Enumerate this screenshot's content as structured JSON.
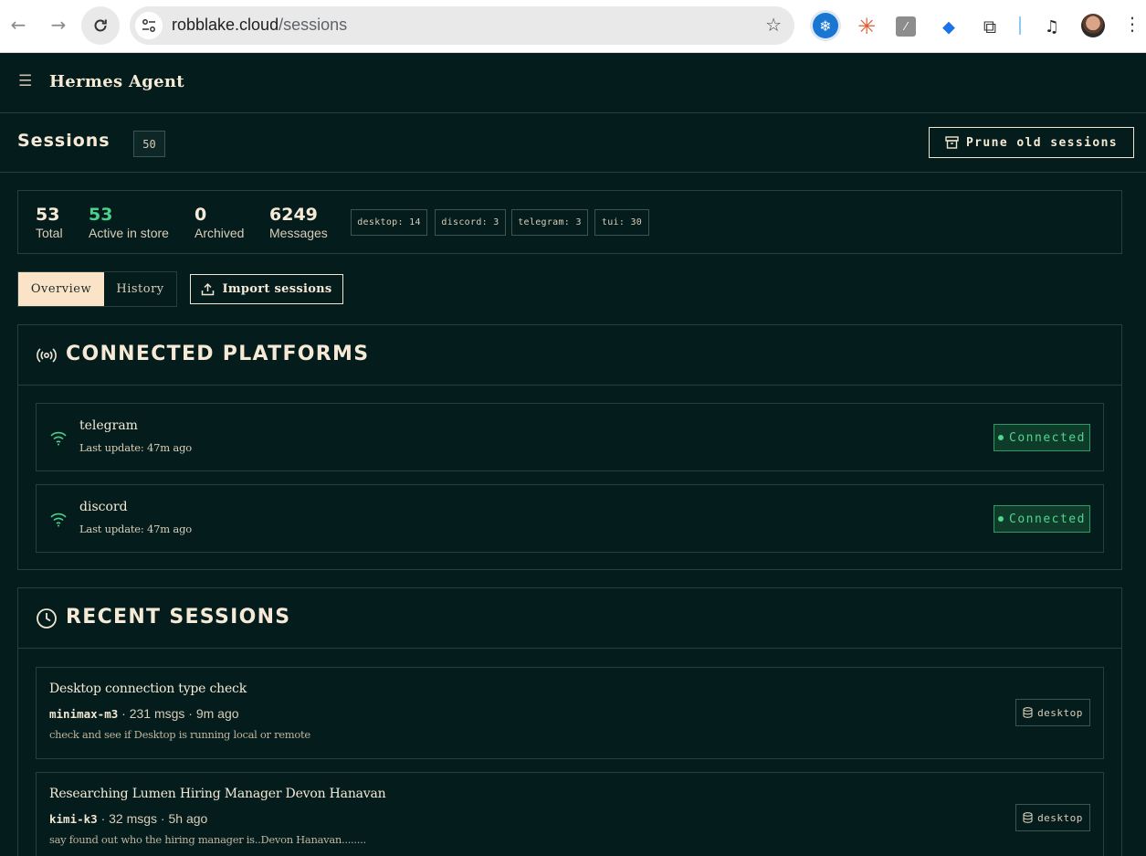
{
  "browser": {
    "url_host": "robblake.cloud",
    "url_path": "/sessions"
  },
  "app": {
    "title": "Hermes Agent"
  },
  "sessions_header": {
    "title": "Sessions",
    "count": "50",
    "prune_label": "Prune old sessions"
  },
  "stats": [
    {
      "value": "53",
      "label": "Total"
    },
    {
      "value": "53",
      "label": "Active in store"
    },
    {
      "value": "0",
      "label": "Archived"
    },
    {
      "value": "6249",
      "label": "Messages"
    }
  ],
  "source_tags": [
    "desktop: 14",
    "discord: 3",
    "telegram: 3",
    "tui: 30"
  ],
  "tabs": [
    {
      "label": "Overview",
      "active": true
    },
    {
      "label": "History",
      "active": false
    }
  ],
  "import_label": "Import sessions",
  "platforms": {
    "title": "CONNECTED PLATFORMS",
    "items": [
      {
        "name": "telegram",
        "update": "Last update: 47m ago",
        "status": "Connected"
      },
      {
        "name": "discord",
        "update": "Last update: 47m ago",
        "status": "Connected"
      }
    ]
  },
  "recent": {
    "title": "RECENT SESSIONS",
    "items": [
      {
        "title": "Desktop connection type check",
        "model": "minimax-m3",
        "meta": " · 231 msgs · 9m ago",
        "desc": "check and see if Desktop is running local or remote",
        "source": "desktop"
      },
      {
        "title": "Researching Lumen Hiring Manager Devon Hanavan",
        "model": "kimi-k3",
        "meta": " · 32 msgs · 5h ago",
        "desc": "say found out who the hiring manager is..Devon Hanavan........",
        "source": "desktop"
      }
    ]
  },
  "colors": {
    "background": "#041c1c",
    "accent_cream": "#fbe3c8",
    "status_green": "#52d48e"
  }
}
